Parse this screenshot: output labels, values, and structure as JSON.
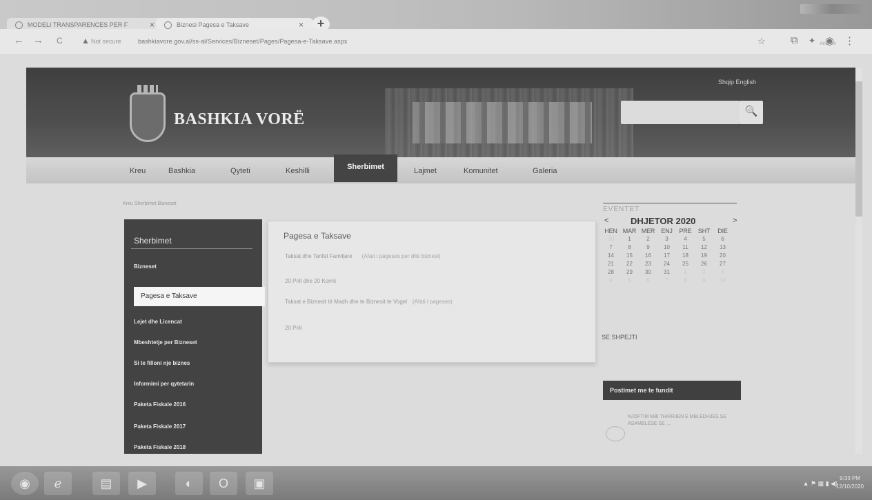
{
  "browser": {
    "tabs": [
      {
        "title": "MODELI TRANSPARENCES PER F",
        "close": "×"
      },
      {
        "title": "Biznesi Pagesa e Taksave",
        "close": "×"
      }
    ],
    "new_tab": "+",
    "nav": {
      "back": "←",
      "forward": "→",
      "reload": "C"
    },
    "security": "Not secure",
    "url": "bashkiavore.gov.al/ss-al/Services/Bizneset/Pages/Pagesa-e-Taksave.aspx",
    "icons": {
      "bookmark": "☆",
      "extension": "⧉",
      "puzzle": "✦",
      "profile": "◉",
      "menu": "⋮"
    },
    "avatar_label": "Anonim"
  },
  "site": {
    "brand": "BASHKIA VORË",
    "languages": "Shqip  English",
    "search_placeholder": "",
    "search_icon": "🔍",
    "nav": [
      "Kreu",
      "Bashkia",
      "Qyteti",
      "Keshilli",
      "Sherbimet",
      "Lajmet",
      "Komunitet",
      "Galeria"
    ],
    "active_nav": "Sherbimet",
    "breadcrumb": "Kreu  Sherbimet  Bizneset"
  },
  "sidebar": {
    "title": "Sherbimet",
    "items": [
      "Bizneset",
      "Pagesa e Taksave",
      "Lejet dhe Licencat",
      "Mbeshtetje per Bizneset",
      "Si te filloni nje biznes",
      "Informimi per qytetarin",
      "Paketa Fiskale 2016",
      "Paketa Fiskale 2017",
      "Paketa Fiskale 2018"
    ],
    "active_item": "Pagesa e Taksave"
  },
  "content": {
    "title": "Pagesa e Taksave",
    "lines": [
      {
        "text": "Taksat dhe Tarifat Familjare",
        "link": "(Afati i pageses per ditë biznesi)"
      },
      {
        "text": "20 Prill dhe 20 Korrik",
        "link": ""
      },
      {
        "text": "Taksat e Biznesit të Madh dhe te Biznesit te Vogel",
        "link": "(Afati i pageses)"
      },
      {
        "text": "20 Prill",
        "link": ""
      }
    ]
  },
  "events": {
    "title": "EVENTET",
    "month": "DHJETOR 2020",
    "prev": "<",
    "next": ">",
    "weekdays": [
      "HEN",
      "MAR",
      "MER",
      "ENJ",
      "PRE",
      "SHT",
      "DIE"
    ],
    "weeks": [
      [
        "30",
        "1",
        "2",
        "3",
        "4",
        "5",
        "6"
      ],
      [
        "7",
        "8",
        "9",
        "10",
        "11",
        "12",
        "13"
      ],
      [
        "14",
        "15",
        "16",
        "17",
        "18",
        "19",
        "20"
      ],
      [
        "21",
        "22",
        "23",
        "24",
        "25",
        "26",
        "27"
      ],
      [
        "28",
        "29",
        "30",
        "31",
        "1",
        "2",
        "3"
      ],
      [
        "4",
        "5",
        "6",
        "7",
        "8",
        "9",
        "10"
      ]
    ],
    "soon_label": "SE SHPEJTI"
  },
  "recent": {
    "title": "Postimet me te fundit",
    "item": "NJOFTIM MBI THIRRJEN E MBLEDHJES SE ASAMBLESE SE ..."
  },
  "taskbar": {
    "tray": "▲  ⚑  ▦  ▮  ◀)",
    "time": "9:33 PM",
    "date": "12/10/2020"
  }
}
